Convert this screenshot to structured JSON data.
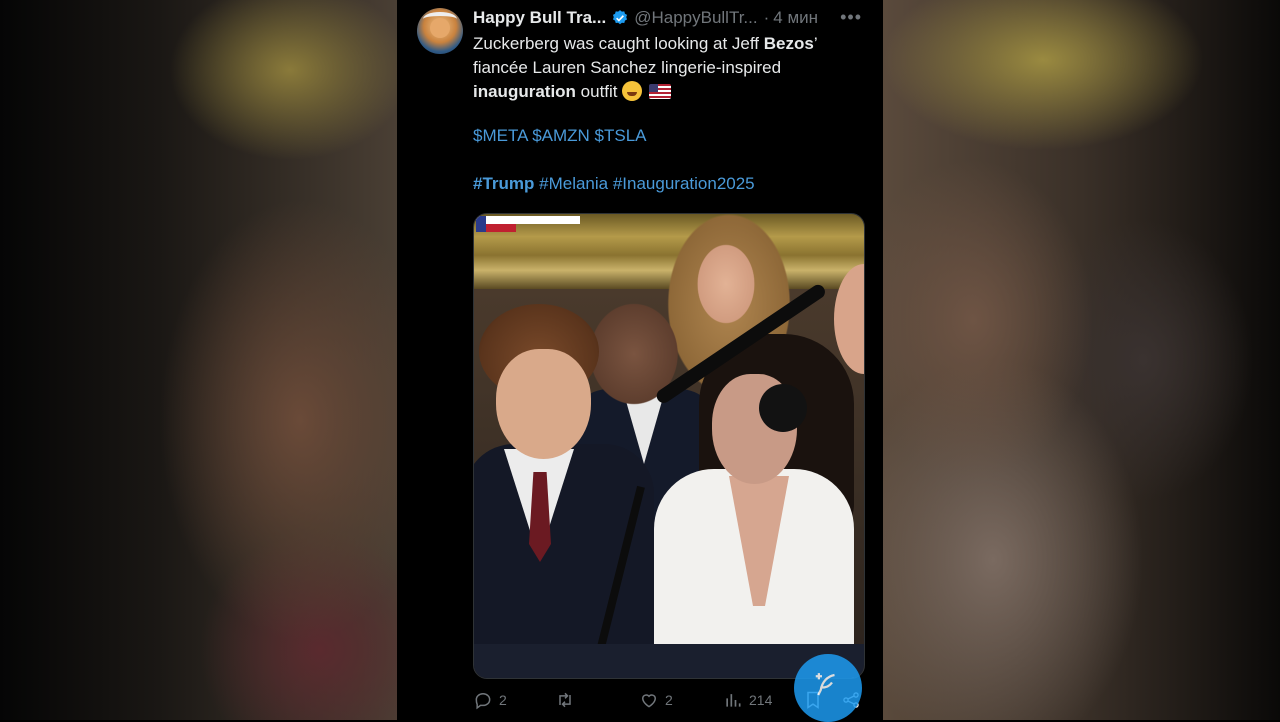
{
  "tweet": {
    "author_name": "Happy Bull Tra...",
    "handle": "@HappyBullTr...",
    "separator": "·",
    "time": "4 мин",
    "more_label": "•••",
    "text": {
      "line1_a": "Zuckerberg was caught looking at Jeff ",
      "line1_b": "Bezos",
      "line1_c": "’",
      "line2": "fiancée Lauren Sanchez lingerie-inspired",
      "line3_a": "inauguration",
      "line3_b": " outfit"
    },
    "tickers": "$META $AMZN $TSLA",
    "hashtags": {
      "first": "#Trump",
      "rest": " #Melania #Inauguration2025"
    }
  },
  "media": {
    "icon": "video-thumbnail"
  },
  "actions": {
    "replies": "2",
    "retweets": "",
    "likes": "2",
    "views": "214"
  },
  "icons": {
    "reply": "reply-icon",
    "retweet": "retweet-icon",
    "like": "heart-icon",
    "views": "views-icon",
    "bookmark": "bookmark-icon",
    "share": "share-icon",
    "compose": "compose-icon",
    "verified": "verified-badge-icon",
    "more": "more-options-icon"
  },
  "colors": {
    "background": "#000000",
    "text": "#e7e9ea",
    "muted": "#71767b",
    "link": "#4a9ad9",
    "accent": "#1d9bf0"
  }
}
